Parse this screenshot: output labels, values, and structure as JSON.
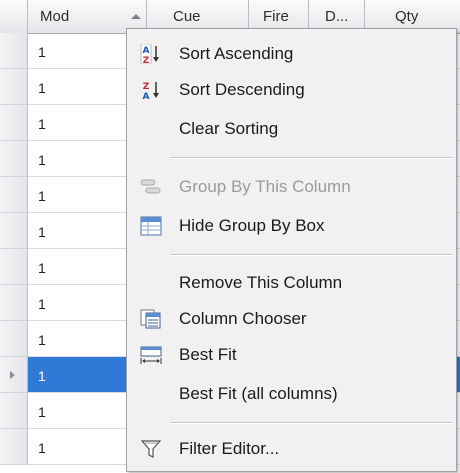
{
  "grid": {
    "columns": [
      "Mod",
      "Cue",
      "Fire",
      "D...",
      "Qty"
    ],
    "rows": [
      "1",
      "1",
      "1",
      "1",
      "1",
      "1",
      "1",
      "1",
      "1",
      "1",
      "1",
      "1"
    ],
    "selected_row_index": 9,
    "accent_color": "#3079d6"
  },
  "menu": {
    "items": [
      {
        "label": "Sort Ascending",
        "icon": "sort-ascending-icon",
        "enabled": true
      },
      {
        "label": "Sort Descending",
        "icon": "sort-descending-icon",
        "enabled": true
      },
      {
        "label": "Clear Sorting",
        "icon": null,
        "enabled": true
      },
      {
        "label": "Group By This Column",
        "icon": "group-by-column-icon",
        "enabled": false
      },
      {
        "label": "Hide Group By Box",
        "icon": "group-by-box-icon",
        "enabled": true
      },
      {
        "label": "Remove This Column",
        "icon": null,
        "enabled": true
      },
      {
        "label": "Column Chooser",
        "icon": "column-chooser-icon",
        "enabled": true
      },
      {
        "label": "Best Fit",
        "icon": "best-fit-icon",
        "enabled": true
      },
      {
        "label": "Best Fit (all columns)",
        "icon": null,
        "enabled": true
      },
      {
        "label": "Filter Editor...",
        "icon": "filter-icon",
        "enabled": true
      }
    ]
  }
}
